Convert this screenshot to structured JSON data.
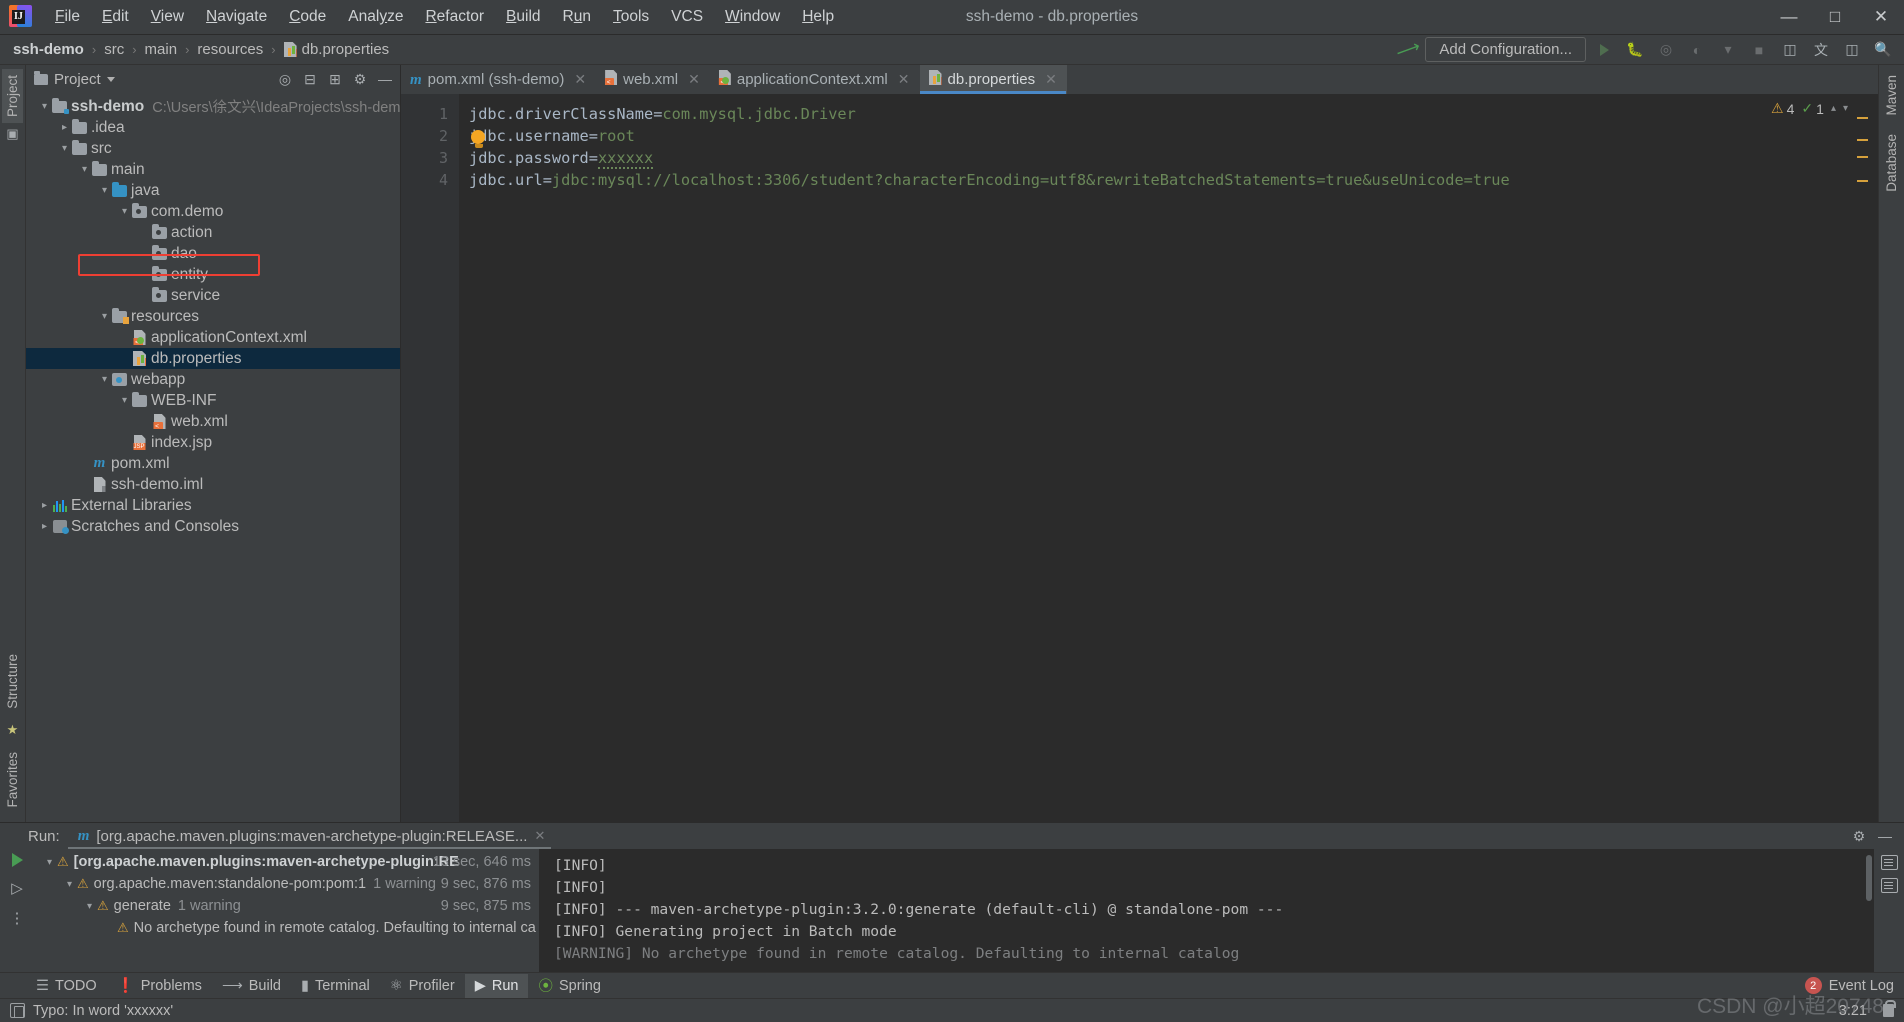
{
  "window": {
    "title": "ssh-demo - db.properties"
  },
  "menu": {
    "items": [
      {
        "label": "File",
        "mnemonic": "F"
      },
      {
        "label": "Edit",
        "mnemonic": "E"
      },
      {
        "label": "View",
        "mnemonic": "V"
      },
      {
        "label": "Navigate",
        "mnemonic": "N"
      },
      {
        "label": "Code",
        "mnemonic": "C"
      },
      {
        "label": "Analyze",
        "mnemonic": "y"
      },
      {
        "label": "Refactor",
        "mnemonic": "R"
      },
      {
        "label": "Build",
        "mnemonic": "B"
      },
      {
        "label": "Run",
        "mnemonic": "n"
      },
      {
        "label": "Tools",
        "mnemonic": "T"
      },
      {
        "label": "VCS",
        "mnemonic": ""
      },
      {
        "label": "Window",
        "mnemonic": "W"
      },
      {
        "label": "Help",
        "mnemonic": "H"
      }
    ]
  },
  "window_controls": {
    "minimize": "—",
    "maximize": "☐",
    "close": "✕"
  },
  "breadcrumb": {
    "items": [
      "ssh-demo",
      "src",
      "main",
      "resources",
      "db.properties"
    ],
    "separator": "›"
  },
  "navbar": {
    "add_configuration": "Add Configuration...",
    "hammer_icon": "build-hammer-icon"
  },
  "project_panel": {
    "title": "Project",
    "tools": [
      "locate-icon",
      "collapse-all-icon",
      "expand-icon",
      "settings-gear-icon",
      "hide-icon"
    ],
    "tree": [
      {
        "depth": 0,
        "arrow": "⌄",
        "icon": "module-folder-icon",
        "label": "ssh-demo",
        "bold": true,
        "sub": "C:\\Users\\徐文兴\\IdeaProjects\\ssh-demo"
      },
      {
        "depth": 1,
        "arrow": "›",
        "icon": "folder-icon",
        "label": ".idea",
        "bold": false,
        "sub": ""
      },
      {
        "depth": 1,
        "arrow": "⌄",
        "icon": "folder-icon",
        "label": "src",
        "bold": false,
        "sub": ""
      },
      {
        "depth": 2,
        "arrow": "⌄",
        "icon": "folder-icon",
        "label": "main",
        "bold": false,
        "sub": ""
      },
      {
        "depth": 3,
        "arrow": "⌄",
        "icon": "source-folder-icon",
        "label": "java",
        "bold": false,
        "sub": ""
      },
      {
        "depth": 4,
        "arrow": "⌄",
        "icon": "package-icon",
        "label": "com.demo",
        "bold": false,
        "sub": ""
      },
      {
        "depth": 5,
        "arrow": "",
        "icon": "package-icon",
        "label": "action",
        "bold": false,
        "sub": ""
      },
      {
        "depth": 5,
        "arrow": "",
        "icon": "package-icon",
        "label": "dao",
        "bold": false,
        "sub": ""
      },
      {
        "depth": 5,
        "arrow": "",
        "icon": "package-icon",
        "label": "entity",
        "bold": false,
        "sub": ""
      },
      {
        "depth": 5,
        "arrow": "",
        "icon": "package-icon",
        "label": "service",
        "bold": false,
        "sub": ""
      },
      {
        "depth": 3,
        "arrow": "⌄",
        "icon": "resources-folder-icon",
        "label": "resources",
        "bold": false,
        "sub": ""
      },
      {
        "depth": 4,
        "arrow": "",
        "icon": "spring-xml-file-icon",
        "label": "applicationContext.xml",
        "bold": false,
        "sub": ""
      },
      {
        "depth": 4,
        "arrow": "",
        "icon": "properties-file-icon",
        "label": "db.properties",
        "bold": false,
        "sub": "",
        "selected": true
      },
      {
        "depth": 3,
        "arrow": "⌄",
        "icon": "webapp-folder-icon",
        "label": "webapp",
        "bold": false,
        "sub": ""
      },
      {
        "depth": 4,
        "arrow": "⌄",
        "icon": "folder-icon",
        "label": "WEB-INF",
        "bold": false,
        "sub": ""
      },
      {
        "depth": 5,
        "arrow": "",
        "icon": "xml-file-icon",
        "label": "web.xml",
        "bold": false,
        "sub": ""
      },
      {
        "depth": 4,
        "arrow": "",
        "icon": "jsp-file-icon",
        "label": "index.jsp",
        "bold": false,
        "sub": ""
      },
      {
        "depth": 2,
        "arrow": "",
        "icon": "maven-pom-icon",
        "label": "pom.xml",
        "bold": false,
        "sub": ""
      },
      {
        "depth": 2,
        "arrow": "",
        "icon": "iml-file-icon",
        "label": "ssh-demo.iml",
        "bold": false,
        "sub": ""
      },
      {
        "depth": 0,
        "arrow": "›",
        "icon": "external-libraries-icon",
        "label": "External Libraries",
        "bold": false,
        "sub": ""
      },
      {
        "depth": 0,
        "arrow": "›",
        "icon": "scratches-icon",
        "label": "Scratches and Consoles",
        "bold": false,
        "sub": ""
      }
    ]
  },
  "left_strip": {
    "top": [
      "Project"
    ],
    "bottom": [
      "Structure",
      "Favorites"
    ]
  },
  "right_strip": {
    "items": [
      "Maven",
      "Database"
    ]
  },
  "editor": {
    "tabs": [
      {
        "label": "pom.xml (ssh-demo)",
        "icon": "maven-pom-icon",
        "active": false,
        "closeable": true
      },
      {
        "label": "web.xml",
        "icon": "xml-file-icon",
        "active": false,
        "closeable": true
      },
      {
        "label": "applicationContext.xml",
        "icon": "spring-xml-file-icon",
        "active": false,
        "closeable": true
      },
      {
        "label": "db.properties",
        "icon": "properties-file-icon",
        "active": true,
        "closeable": true
      }
    ],
    "line_numbers": [
      "1",
      "2",
      "3",
      "4"
    ],
    "lines": [
      {
        "key": "jdbc.driverClassName",
        "value": "com.mysql.jdbc.Driver"
      },
      {
        "key": "jdbc.username",
        "value": "root"
      },
      {
        "key": "jdbc.password",
        "value": "xxxxxx",
        "typo": true
      },
      {
        "key": "jdbc.url",
        "value": "jdbc:mysql://localhost:3306/student?characterEncoding=utf8&rewriteBatchedStatements=true&useUnicode=true"
      }
    ],
    "inspection": {
      "warning_count": "4",
      "ok_count": "1",
      "warning_icon": "warning-triangle-icon",
      "ok_icon": "checkmark-icon"
    },
    "colors": {
      "key": "#9876aa",
      "value": "#6a8759",
      "background": "#2b2b2b",
      "gutter": "#313335"
    }
  },
  "run_panel": {
    "label": "Run:",
    "tab_title": "[org.apache.maven.plugins:maven-archetype-plugin:RELEASE...",
    "tab_icon": "maven-pom-icon",
    "tree": [
      {
        "depth": 0,
        "arrow": "⌄",
        "label": "[org.apache.maven.plugins:maven-archetype-plugin:RE",
        "bold": true,
        "warning": "",
        "time": "13 sec, 646 ms"
      },
      {
        "depth": 1,
        "arrow": "⌄",
        "label": "org.apache.maven:standalone-pom:pom:1",
        "bold": false,
        "warning": "1 warning",
        "time": "9 sec, 876 ms"
      },
      {
        "depth": 2,
        "arrow": "⌄",
        "label": "generate",
        "bold": false,
        "warning": "1 warning",
        "time": "9 sec, 875 ms"
      },
      {
        "depth": 3,
        "arrow": "",
        "label": "No archetype found in remote catalog. Defaulting to internal ca",
        "bold": false,
        "warning": "",
        "time": ""
      }
    ],
    "console": [
      "[INFO] ",
      "[INFO] ",
      "[INFO] --- maven-archetype-plugin:3.2.0:generate (default-cli) @ standalone-pom ---",
      "[INFO] Generating project in Batch mode",
      "[WARNING] No archetype found in remote catalog. Defaulting to internal catalog"
    ]
  },
  "bottom_tabs": [
    {
      "label": "TODO",
      "icon": "todo-list-icon",
      "active": false
    },
    {
      "label": "Problems",
      "icon": "problems-icon",
      "active": false
    },
    {
      "label": "Build",
      "icon": "build-hammer-icon",
      "active": false
    },
    {
      "label": "Terminal",
      "icon": "terminal-icon",
      "active": false
    },
    {
      "label": "Profiler",
      "icon": "profiler-icon",
      "active": false
    },
    {
      "label": "Run",
      "icon": "run-play-icon",
      "active": true
    },
    {
      "label": "Spring",
      "icon": "spring-leaf-icon",
      "active": false
    }
  ],
  "event_log": {
    "label": "Event Log",
    "count": "2"
  },
  "status_bar": {
    "message": "Typo: In word 'xxxxxx'",
    "caret_position": "3:21",
    "encoding_hint": "",
    "lock_icon": "lock-icon"
  },
  "watermark": {
    "text": "CSDN @小超20748"
  }
}
